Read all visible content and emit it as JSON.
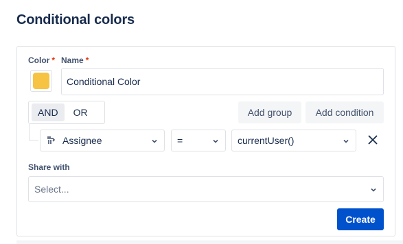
{
  "page": {
    "title": "Conditional colors"
  },
  "form": {
    "color_label": "Color",
    "name_label": "Name",
    "required_marker": "*",
    "color_value": "#f6c342",
    "name_value": "Conditional Color",
    "logic": {
      "and_label": "AND",
      "or_label": "OR",
      "active": "AND"
    },
    "add_group_label": "Add group",
    "add_condition_label": "Add condition",
    "condition": {
      "field": "Assignee",
      "field_icon": "assignee-field-icon",
      "operator": "=",
      "value": "currentUser()",
      "remove_icon": "close-icon"
    },
    "share_label": "Share with",
    "share_placeholder": "Select...",
    "create_label": "Create"
  },
  "colors": {
    "primary": "#0052cc",
    "text": "#172b4d",
    "border": "#dfe1e6",
    "required": "#de350b"
  }
}
